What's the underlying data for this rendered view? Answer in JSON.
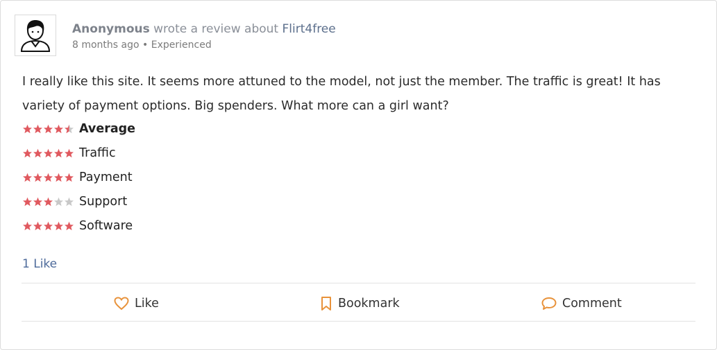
{
  "review": {
    "author": "Anonymous",
    "action_text": " wrote a review about ",
    "site": "Flirt4free",
    "time": "8 months ago",
    "separator": " • ",
    "level": "Experienced",
    "text": "I really like this site. It seems more attuned to the model, not just the member. The traffic is great! It has variety of payment options. Big spenders. What more can a girl want?"
  },
  "ratings": [
    {
      "label": "Average",
      "stars": 4.5,
      "max": 5
    },
    {
      "label": "Traffic",
      "stars": 5,
      "max": 5
    },
    {
      "label": "Payment",
      "stars": 5,
      "max": 5
    },
    {
      "label": "Support",
      "stars": 3,
      "max": 5
    },
    {
      "label": "Software",
      "stars": 5,
      "max": 5
    }
  ],
  "likes_text": "1 Like",
  "actions": {
    "like": "Like",
    "bookmark": "Bookmark",
    "comment": "Comment"
  },
  "colors": {
    "star_filled": "#e0595f",
    "star_empty": "#c8c8c8",
    "action_icon": "#e8923a",
    "link": "#4d6a9a"
  },
  "icons": {
    "avatar": "user-avatar-icon",
    "like": "heart-icon",
    "bookmark": "bookmark-icon",
    "comment": "comment-bubble-icon"
  }
}
